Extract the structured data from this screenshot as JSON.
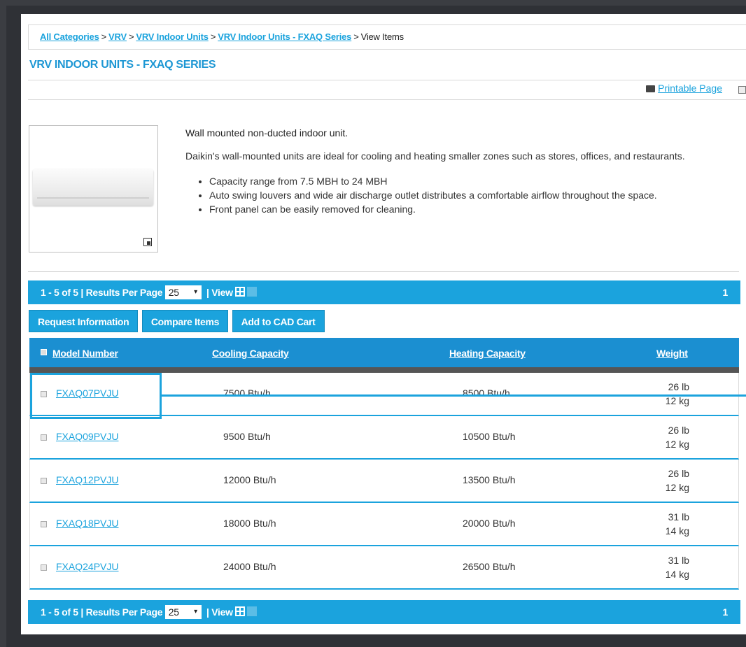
{
  "breadcrumb": {
    "items": [
      "All Categories",
      "VRV",
      "VRV Indoor Units",
      "VRV Indoor Units - FXAQ Series"
    ],
    "current": "View Items",
    "separator": ">"
  },
  "title": "VRV INDOOR UNITS - FXAQ SERIES",
  "printable_label": "Printable Page",
  "description": {
    "lead": "Wall mounted non-ducted indoor unit.",
    "paragraph": "Daikin's wall-mounted units are ideal for cooling and heating smaller zones such as stores, offices, and restaurants.",
    "bullets": [
      "Capacity range from 7.5 MBH to 24 MBH",
      "Auto swing louvers and wide air discharge outlet distributes a comfortable airflow throughout the space.",
      "Front panel can be easily removed for cleaning."
    ]
  },
  "pager": {
    "range": "1 - 5 of 5",
    "separator": "|",
    "per_page_label": "Results Per Page",
    "per_page_value": "25",
    "view_label": "View",
    "page": "1"
  },
  "actions": {
    "request": "Request Information",
    "compare": "Compare Items",
    "cad": "Add to CAD Cart"
  },
  "table": {
    "headers": {
      "model": "Model Number",
      "cooling": "Cooling Capacity",
      "heating": "Heating Capacity",
      "weight": "Weight"
    },
    "rows": [
      {
        "model": "FXAQ07PVJU",
        "cooling": "7500 Btu/h",
        "heating": "8500 Btu/h",
        "weight_lb": "26 lb",
        "weight_kg": "12 kg"
      },
      {
        "model": "FXAQ09PVJU",
        "cooling": "9500 Btu/h",
        "heating": "10500 Btu/h",
        "weight_lb": "26 lb",
        "weight_kg": "12 kg"
      },
      {
        "model": "FXAQ12PVJU",
        "cooling": "12000 Btu/h",
        "heating": "13500 Btu/h",
        "weight_lb": "26 lb",
        "weight_kg": "12 kg"
      },
      {
        "model": "FXAQ18PVJU",
        "cooling": "18000 Btu/h",
        "heating": "20000 Btu/h",
        "weight_lb": "31 lb",
        "weight_kg": "14 kg"
      },
      {
        "model": "FXAQ24PVJU",
        "cooling": "24000 Btu/h",
        "heating": "26500 Btu/h",
        "weight_lb": "31 lb",
        "weight_kg": "14 kg"
      }
    ]
  },
  "colors": {
    "accent": "#1ba3dd",
    "header": "#1b8fd1",
    "title": "#1d97d4"
  }
}
